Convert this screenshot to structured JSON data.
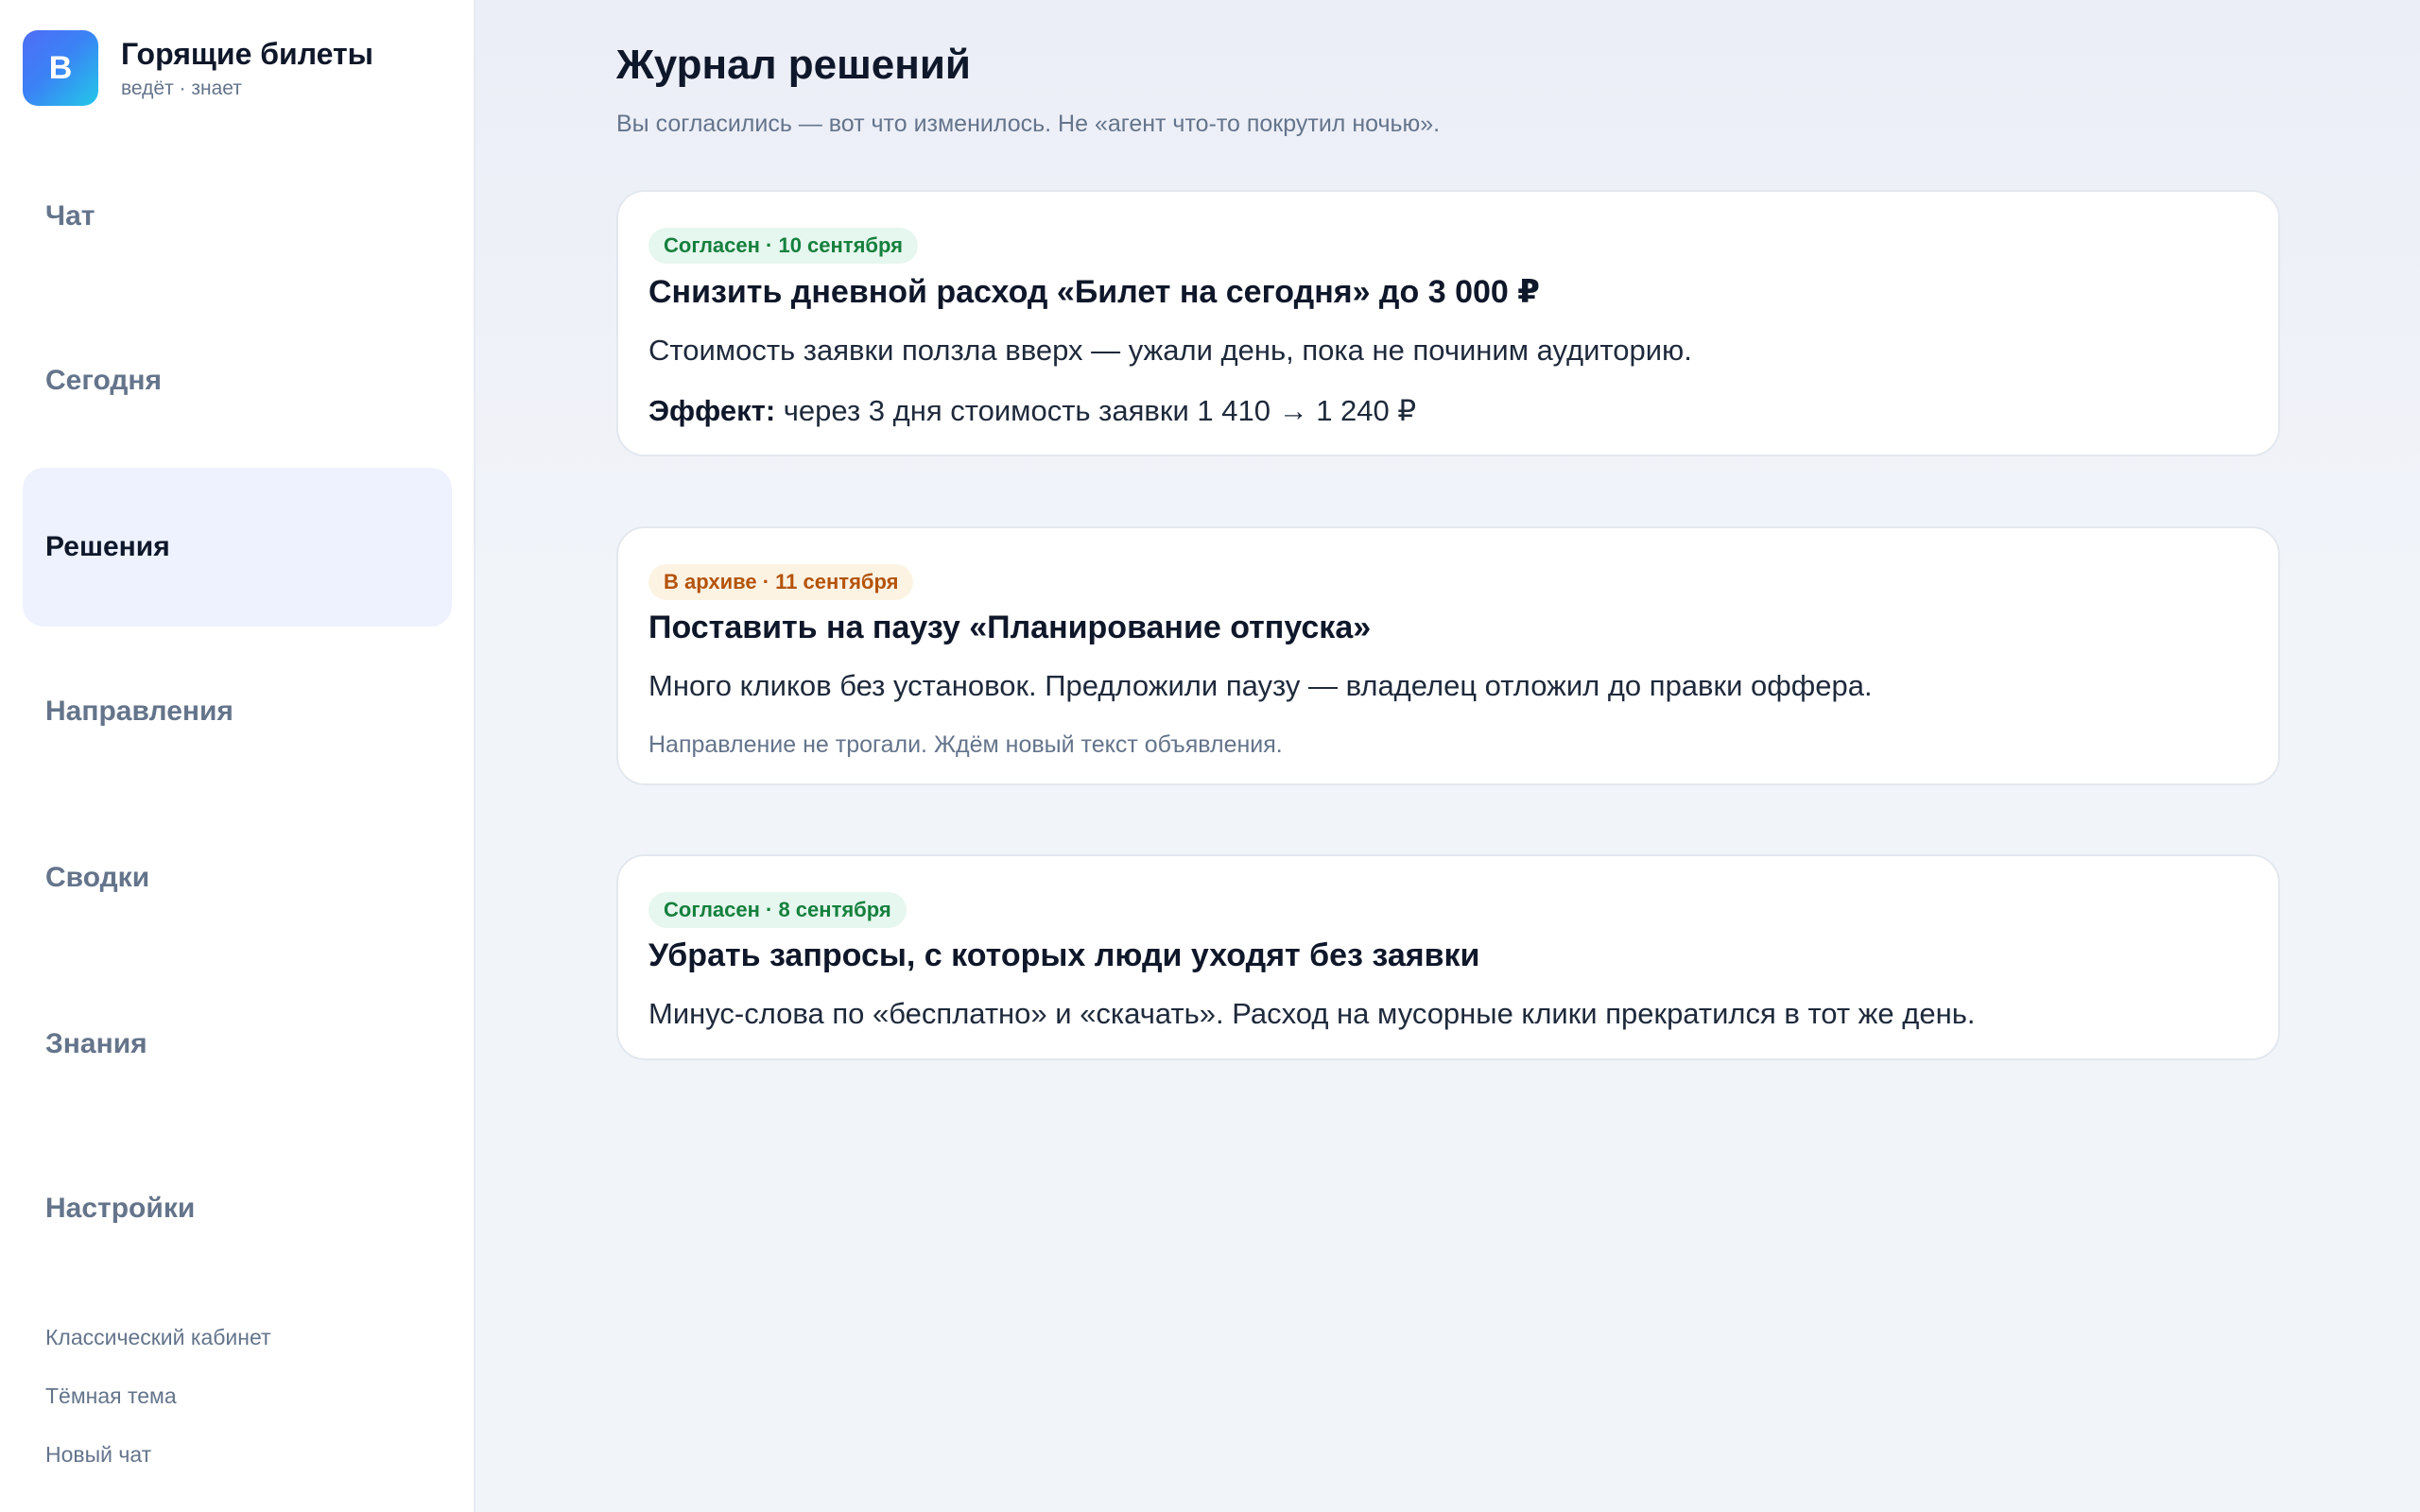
{
  "brand": {
    "logo_letter": "В",
    "title": "Горящие билеты",
    "subtitle": "ведёт · знает"
  },
  "nav": {
    "items": [
      {
        "label": "Чат"
      },
      {
        "label": "Сегодня"
      },
      {
        "label": "Решения",
        "active": true
      },
      {
        "label": "Направления"
      },
      {
        "label": "Сводки"
      },
      {
        "label": "Знания"
      },
      {
        "label": "Настройки"
      }
    ]
  },
  "footer": {
    "classic_cabinet": "Классический кабинет",
    "dark_theme": "Тёмная тема",
    "new_chat": "Новый чат"
  },
  "page": {
    "title": "Журнал решений",
    "subtitle": "Вы согласились — вот что изменилось. Не «агент что-то покрутил ночью»."
  },
  "decisions": [
    {
      "status": "Согласен · 10 сентября",
      "status_color": "#15803d",
      "title": "Снизить дневной расход «Билет на сегодня» до 3 000 ₽",
      "description": "Стоимость заявки ползла вверх — ужали день, пока не починим аудиторию.",
      "effect_label": "Эффект:",
      "effect_text": " через 3 дня стоимость заявки 1 410 → 1 240 ₽"
    },
    {
      "status": "В архиве · 11 сентября",
      "status_color": "#b45309",
      "title": "Поставить на паузу «Планирование отпуска»",
      "description": "Много кликов без установок. Предложили паузу — владелец отложил до правки оффера.",
      "note": "Направление не трогали. Ждём новый текст объявления."
    },
    {
      "status": "Согласен · 8 сентября",
      "status_color": "#15803d",
      "title": "Убрать запросы, с которых люди уходят без заявки",
      "description": "Минус-слова по «бесплатно» и «скачать». Расход на мусорные клики прекратился в тот же день."
    }
  ]
}
